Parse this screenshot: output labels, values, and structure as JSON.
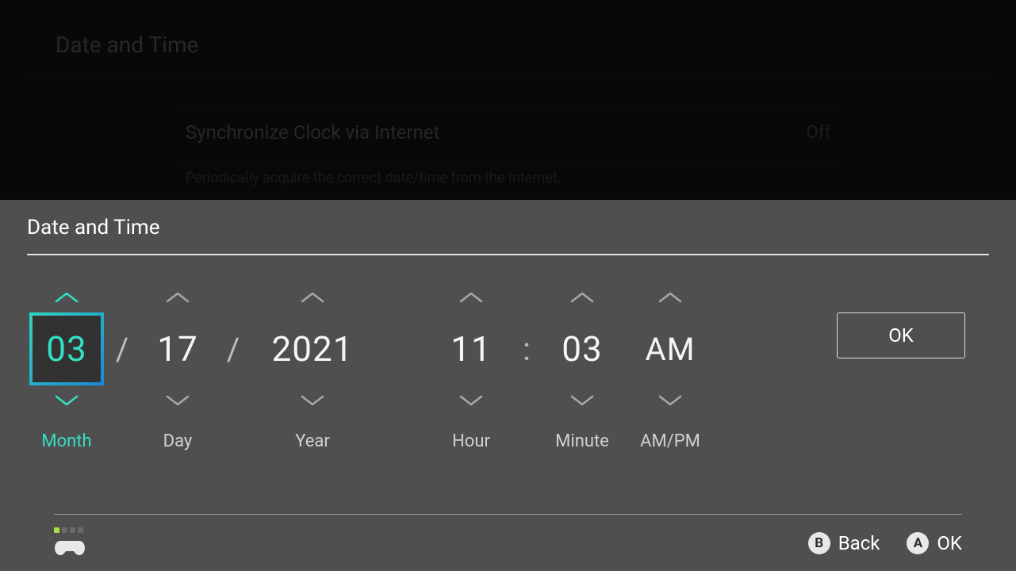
{
  "bg": {
    "title": "Date and Time",
    "sync_label": "Synchronize Clock via Internet",
    "sync_value": "Off",
    "sync_desc": "Periodically acquire the correct date/time from the Internet."
  },
  "panel": {
    "title": "Date and Time",
    "ok_label": "OK",
    "fields": {
      "month": {
        "value": "03",
        "label": "Month",
        "selected": true
      },
      "day": {
        "value": "17",
        "label": "Day",
        "selected": false
      },
      "year": {
        "value": "2021",
        "label": "Year",
        "selected": false
      },
      "hour": {
        "value": "11",
        "label": "Hour",
        "selected": false
      },
      "minute": {
        "value": "03",
        "label": "Minute",
        "selected": false
      },
      "ampm": {
        "value": "AM",
        "label": "AM/PM",
        "selected": false
      }
    },
    "separators": {
      "date": "/",
      "time": ":"
    }
  },
  "footer": {
    "back_label": "Back",
    "ok_label": "OK",
    "back_glyph": "B",
    "ok_glyph": "A"
  }
}
